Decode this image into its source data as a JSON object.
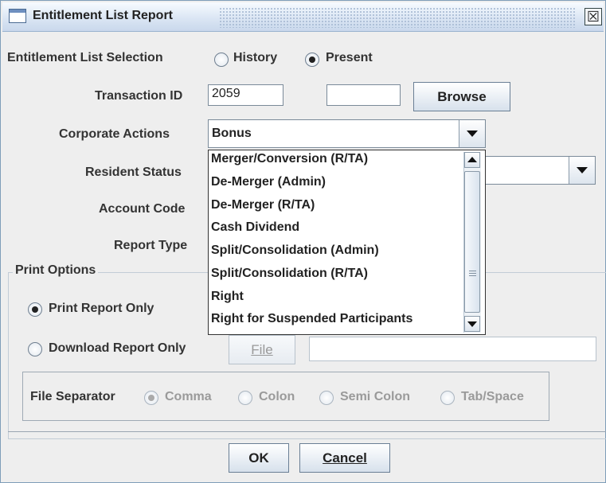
{
  "window": {
    "title": "Entitlement List Report",
    "close_glyph": "☒"
  },
  "selection": {
    "label": "Entitlement List Selection",
    "options": [
      {
        "label": "History",
        "checked": false
      },
      {
        "label": "Present",
        "checked": true
      }
    ]
  },
  "transaction": {
    "label": "Transaction ID",
    "value": "2059",
    "value2": "",
    "browse_label": "Browse"
  },
  "corporate_actions": {
    "label": "Corporate Actions",
    "selected": "Bonus",
    "dropdown_items": [
      "Merger/Conversion (R/TA)",
      "De-Merger (Admin)",
      "De-Merger (R/TA)",
      "Cash Dividend",
      "Split/Consolidation (Admin)",
      "Split/Consolidation (R/TA)",
      "Right",
      "Right for Suspended Participants"
    ]
  },
  "resident_status": {
    "label": "Resident Status",
    "value": ""
  },
  "account_code": {
    "label": "Account Code"
  },
  "report_type": {
    "label": "Report Type"
  },
  "print_options": {
    "legend": "Print Options",
    "print_only": {
      "label": "Print Report Only",
      "checked": true
    },
    "download_only": {
      "label": "Download Report Only",
      "checked": false
    },
    "file_button": "File",
    "file_path": ""
  },
  "file_separator": {
    "label": "File Separator",
    "options": [
      {
        "label": "Comma",
        "checked": true
      },
      {
        "label": "Colon",
        "checked": false
      },
      {
        "label": "Semi Colon",
        "checked": false
      },
      {
        "label": "Tab/Space",
        "checked": false
      }
    ]
  },
  "buttons": {
    "ok": "OK",
    "cancel": "Cancel"
  }
}
